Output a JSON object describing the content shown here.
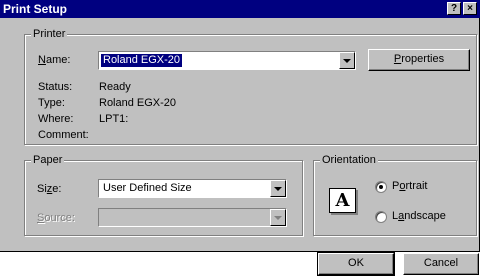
{
  "title": "Print Setup",
  "title_buttons": {
    "help": "?",
    "close": "×"
  },
  "printer": {
    "legend": "Printer",
    "name_label": "Name:",
    "name_value": "Roland EGX-20",
    "properties_button": "Properties",
    "status_label": "Status:",
    "status_value": "Ready",
    "type_label": "Type:",
    "type_value": "Roland EGX-20",
    "where_label": "Where:",
    "where_value": "LPT1:",
    "comment_label": "Comment:",
    "comment_value": ""
  },
  "paper": {
    "legend": "Paper",
    "size_label": "Size:",
    "size_value": "User Defined Size",
    "source_label": "Source:",
    "source_value": ""
  },
  "orientation": {
    "legend": "Orientation",
    "icon_letter": "A",
    "portrait_label": "Portrait",
    "landscape_label": "Landscape",
    "selected": "Portrait"
  },
  "buttons": {
    "ok": "OK",
    "cancel": "Cancel"
  }
}
